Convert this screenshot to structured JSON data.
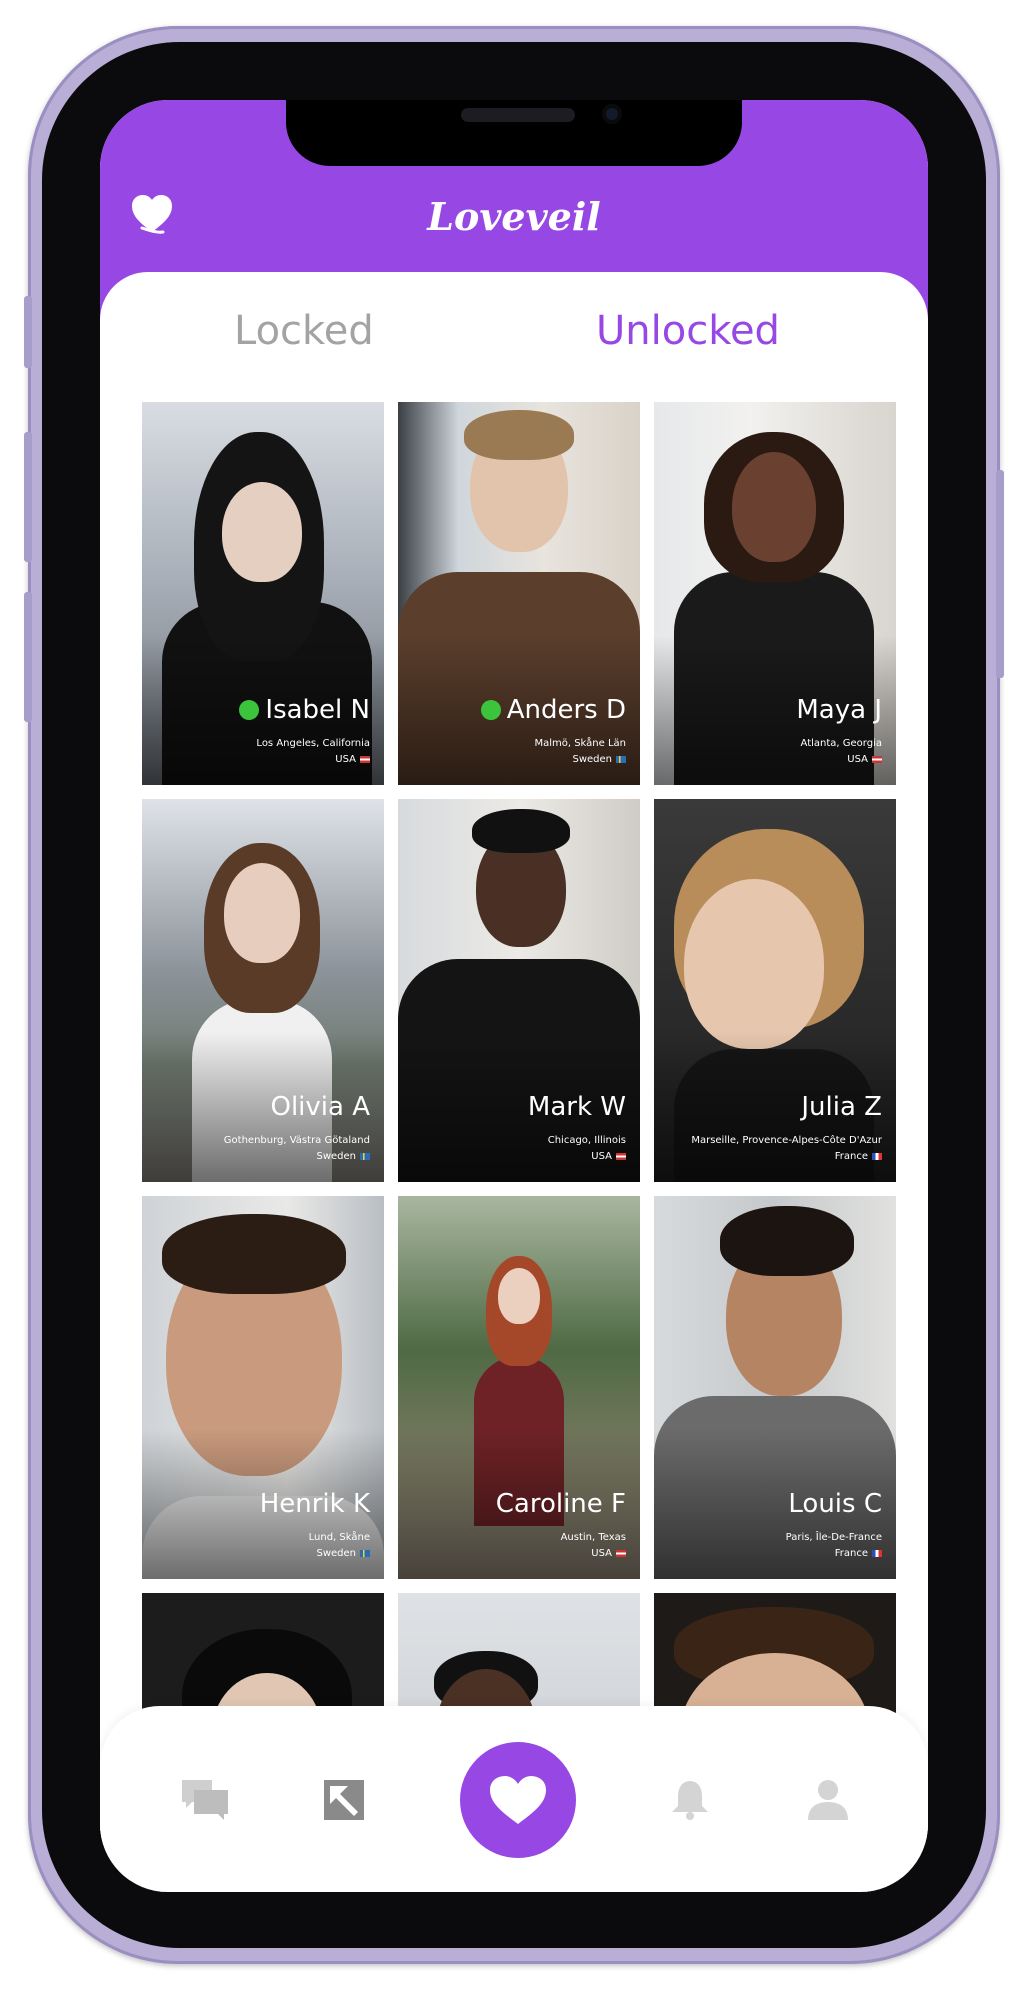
{
  "app": {
    "title": "Loveveil",
    "accent_color": "#9748e4",
    "logo_icon": "heart-icon"
  },
  "tabs": [
    {
      "label": "Locked",
      "active": false
    },
    {
      "label": "Unlocked",
      "active": true
    }
  ],
  "profiles": [
    {
      "name": "Isabel N",
      "location": "Los Angeles, California",
      "country": "USA",
      "flag": "flag-usa",
      "online": true
    },
    {
      "name": "Anders D",
      "location": "Malmö, Skåne Län",
      "country": "Sweden",
      "flag": "flag-sweden",
      "online": true
    },
    {
      "name": "Maya J",
      "location": "Atlanta, Georgia",
      "country": "USA",
      "flag": "flag-usa",
      "online": false
    },
    {
      "name": "Olivia A",
      "location": "Gothenburg, Västra Götaland",
      "country": "Sweden",
      "flag": "flag-sweden",
      "online": false
    },
    {
      "name": "Mark W",
      "location": "Chicago, Illinois",
      "country": "USA",
      "flag": "flag-usa",
      "online": false
    },
    {
      "name": "Julia Z",
      "location": "Marseille, Provence-Alpes-Côte D'Azur",
      "country": "France",
      "flag": "flag-france",
      "online": false
    },
    {
      "name": "Henrik K",
      "location": "Lund, Skåne",
      "country": "Sweden",
      "flag": "flag-sweden",
      "online": false
    },
    {
      "name": "Caroline F",
      "location": "Austin, Texas",
      "country": "USA",
      "flag": "flag-usa",
      "online": false
    },
    {
      "name": "Louis C",
      "location": "Paris, Île-De-France",
      "country": "France",
      "flag": "flag-france",
      "online": false
    }
  ],
  "bottom_nav": [
    {
      "icon": "chat-icon",
      "active": false
    },
    {
      "icon": "image-icon",
      "active": false
    },
    {
      "icon": "heart-icon",
      "active": true
    },
    {
      "icon": "bell-icon",
      "active": false
    },
    {
      "icon": "profile-icon",
      "active": false
    }
  ]
}
